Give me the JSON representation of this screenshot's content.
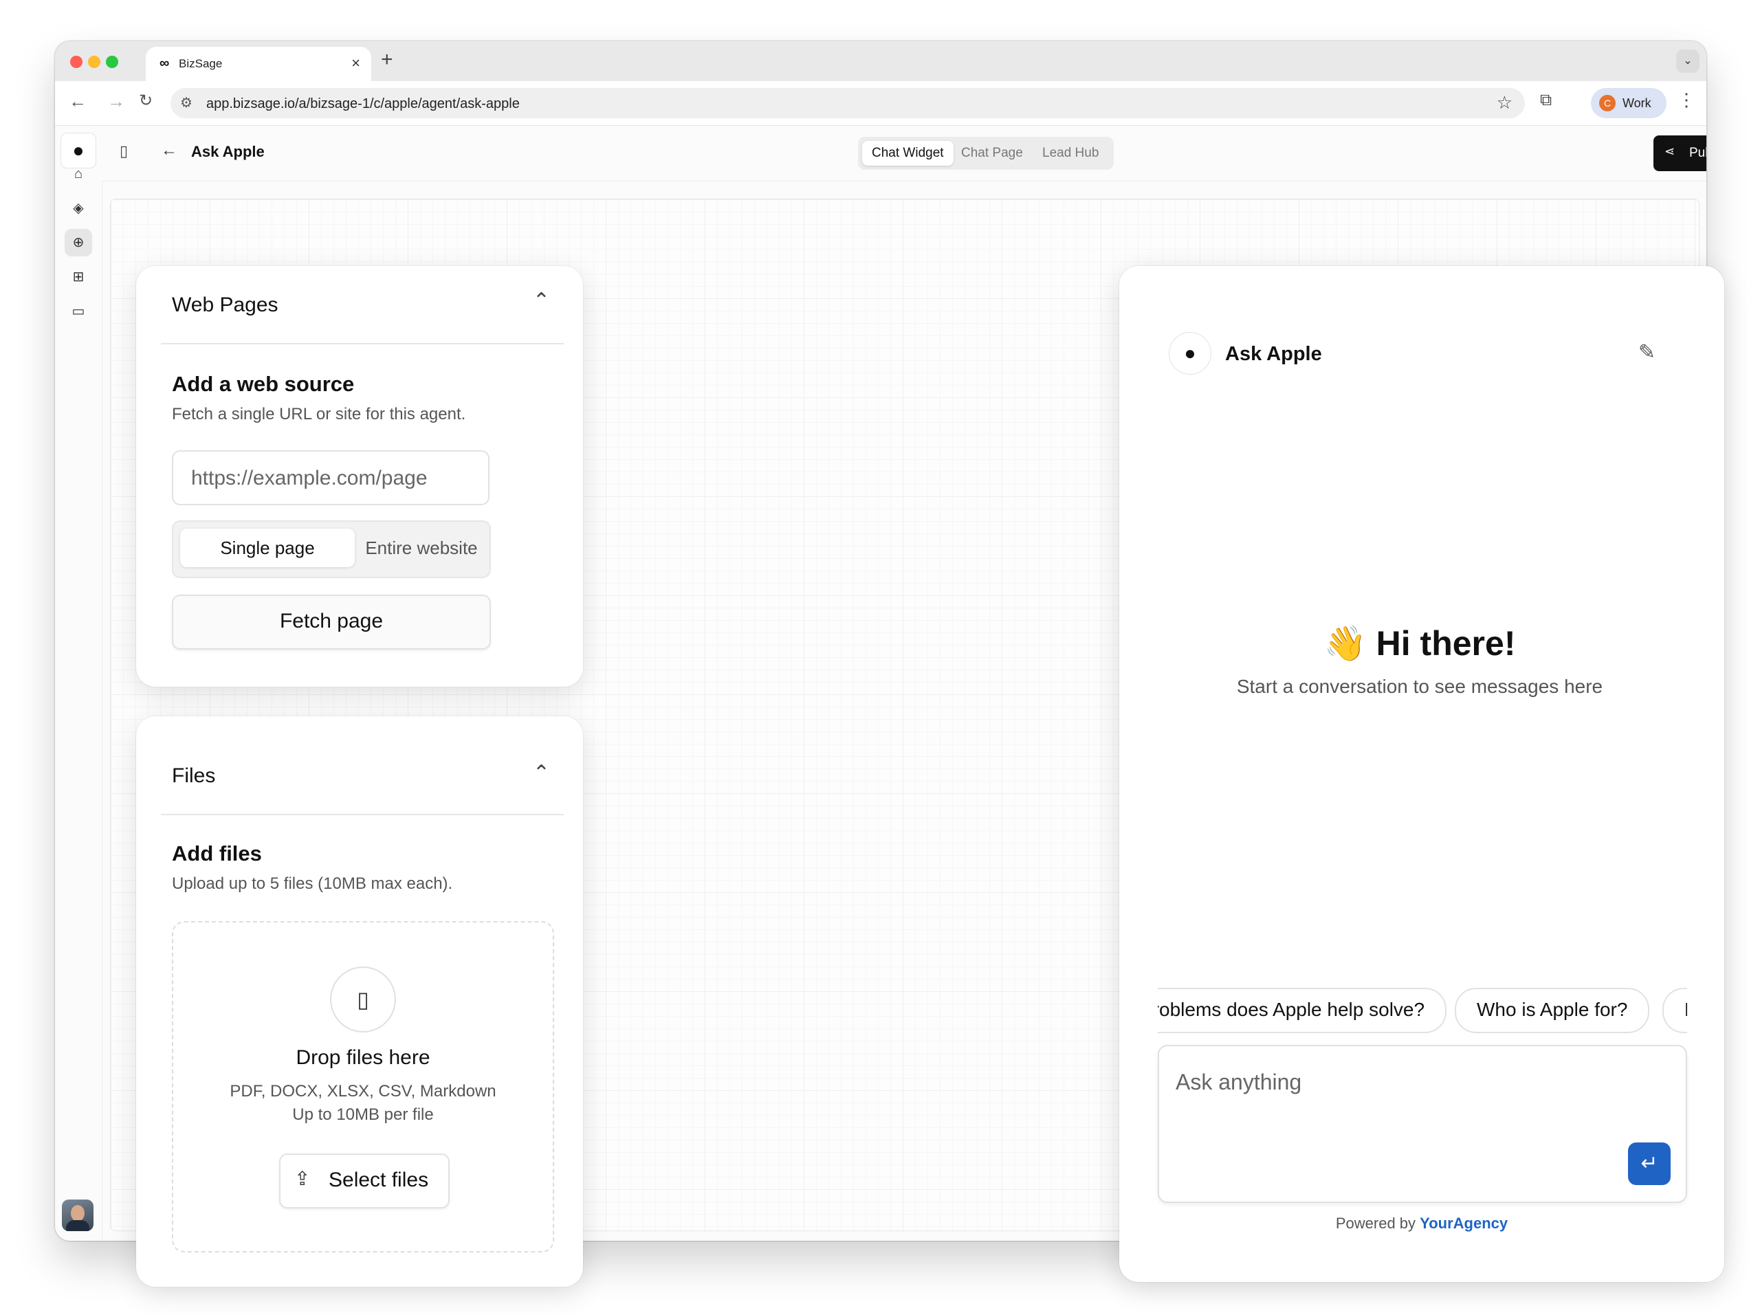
{
  "browser": {
    "tab_title": "BizSage",
    "tab_close": "×",
    "new_tab": "+",
    "url": "app.bizsage.io/a/bizsage-1/c/apple/agent/ask-apple",
    "profile_initial": "C",
    "profile_label": "Work"
  },
  "header": {
    "title": "Ask Apple",
    "view_tabs": [
      "Chat Widget",
      "Chat Page",
      "Lead Hub"
    ],
    "active_tab": "Chat Widget",
    "publish_label": "Publish"
  },
  "sidebar": {
    "icons": [
      "bot-icon",
      "paint-bucket-icon",
      "brain-icon",
      "gift-icon",
      "folder-icon"
    ],
    "active_icon": "brain-icon"
  },
  "web_pages": {
    "section_title": "Web Pages",
    "heading": "Add a web source",
    "description": "Fetch a single URL or site for this agent.",
    "url_placeholder": "https://example.com/page",
    "mode_options": [
      "Single page",
      "Entire website"
    ],
    "selected_mode": "Single page",
    "fetch_label": "Fetch page"
  },
  "files": {
    "section_title": "Files",
    "heading": "Add files",
    "description": "Upload up to 5 files (10MB max each).",
    "drop_title": "Drop files here",
    "drop_formats": "PDF, DOCX, XLSX, CSV, Markdown",
    "drop_limit": "Up to 10MB per file",
    "select_label": "Select files"
  },
  "chat_widget": {
    "name": "Ask Apple",
    "greeting": "👋 Hi there!",
    "greeting_sub": "Start a conversation to see messages here",
    "suggestions": [
      "What problems does Apple help solve?",
      "Who is Apple for?",
      "How"
    ],
    "input_placeholder": "Ask anything",
    "powered_prefix": "Powered by",
    "powered_brand": "YourAgency",
    "accent_color": "#1f64c4"
  }
}
